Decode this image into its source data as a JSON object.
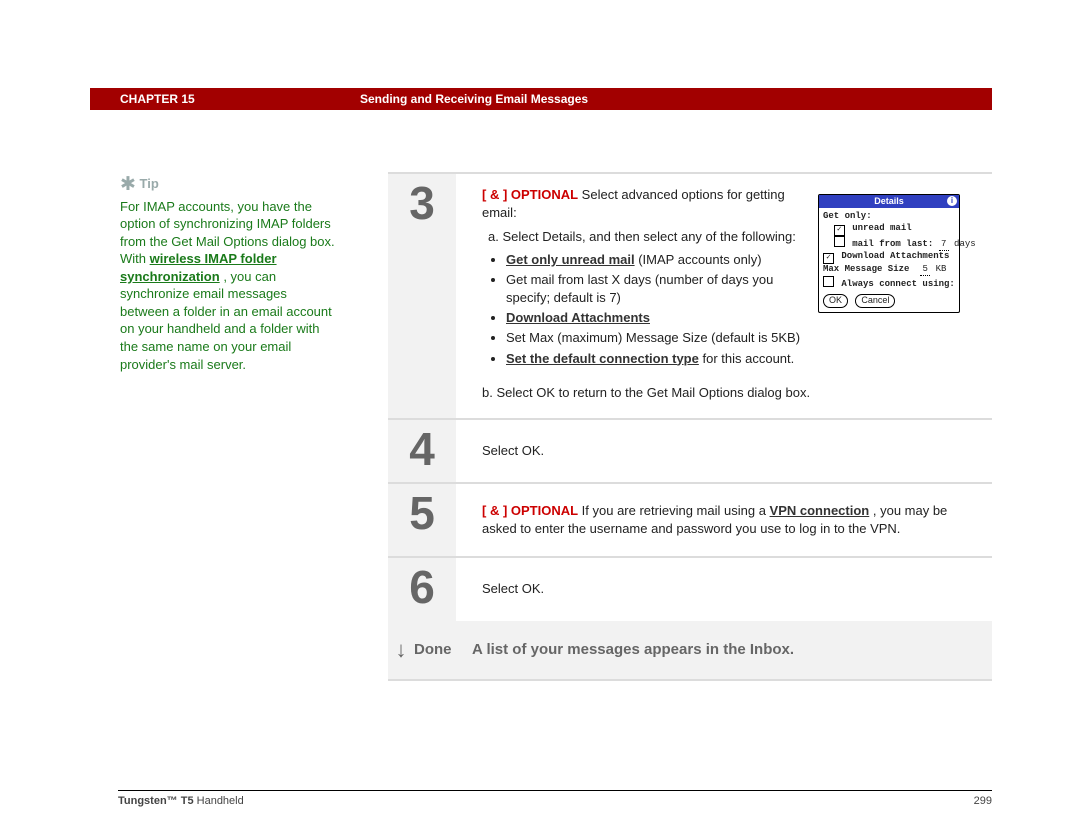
{
  "header": {
    "chapter_label": "CHAPTER 15",
    "chapter_title": "Sending and Receiving Email Messages"
  },
  "tip": {
    "heading": "Tip",
    "body_pre": "For IMAP accounts, you have the option of synchronizing IMAP folders from the Get Mail Options dialog box. With ",
    "link": "wireless IMAP folder synchronization",
    "body_post": ", you can synchronize email messages between a folder in an email account on your handheld and a folder with the same name on your email provider's mail server."
  },
  "steps": {
    "s3": {
      "num": "3",
      "optional_tag": "[ & ]  OPTIONAL",
      "lead": "   Select advanced options for getting email:",
      "a_label": "a.",
      "a_text": "Select Details, and then select any of the following:",
      "b1_link": "Get only unread mail",
      "b1_note": " (IMAP accounts only)",
      "b2": "Get mail from last X days (number of days you specify; default is 7)",
      "b3_link": "Download Attachments",
      "b4": "Set Max (maximum) Message Size (default is 5KB)",
      "b5_link": "Set the default connection type",
      "b5_post": " for this account.",
      "b_label": "b.",
      "b_text": "Select OK to return to the Get Mail Options dialog box."
    },
    "s4": {
      "num": "4",
      "text": "Select OK."
    },
    "s5": {
      "num": "5",
      "optional_tag": "[ & ]  OPTIONAL",
      "pre": "   If you are retrieving mail using a ",
      "link": "VPN connection",
      "post": ", you may be asked to enter the username and password you use to log in to the VPN."
    },
    "s6": {
      "num": "6",
      "text": "Select OK."
    }
  },
  "done": {
    "label": "Done",
    "text": "A list of your messages appears in the Inbox."
  },
  "details_dialog": {
    "title": "Details",
    "get_only": "Get only:",
    "unread": "unread mail",
    "mail_from_last": "mail from last:",
    "days_value": "7",
    "days_unit": "days",
    "download_att": "Download Attachments",
    "max_size_label": "Max Message Size",
    "max_size_value": "5",
    "max_size_unit": "KB",
    "always_connect": "Always connect using:",
    "ok": "OK",
    "cancel": "Cancel"
  },
  "footer": {
    "product_bold": "Tungsten™ T5",
    "product_rest": " Handheld",
    "page": "299"
  }
}
